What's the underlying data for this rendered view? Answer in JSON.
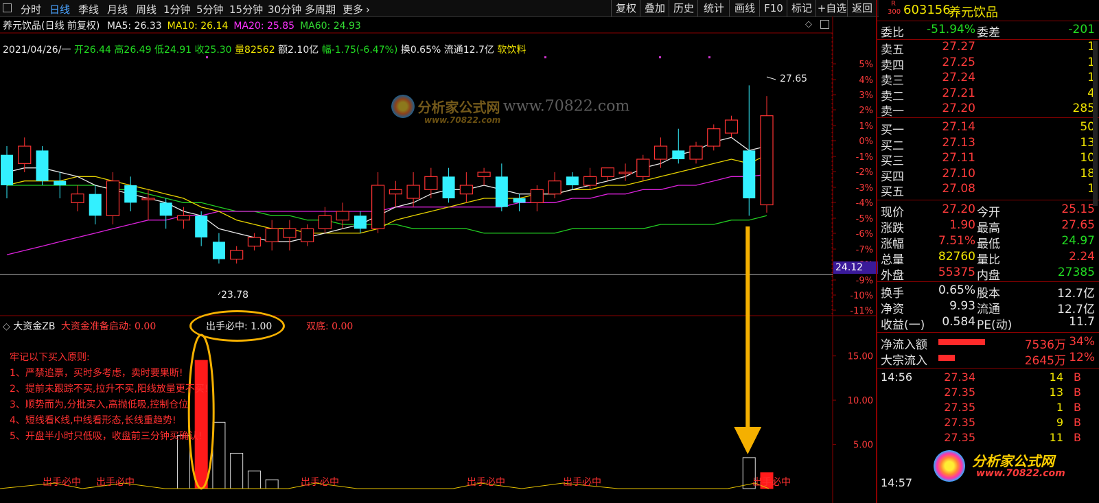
{
  "toolbar": {
    "tabs": [
      "分时",
      "日线",
      "季线",
      "月线",
      "周线",
      "1分钟",
      "5分钟",
      "15分钟",
      "30分钟",
      "多周期",
      "更多"
    ],
    "active_tab": "日线",
    "right_buttons": [
      "复权",
      "叠加",
      "历史",
      "统计",
      "画线",
      "F10",
      "标记",
      "+自选",
      "返回"
    ]
  },
  "title_bar": {
    "stock_title": "养元饮品(日线 前复权)",
    "ma": [
      {
        "label": "MA5: 26.33",
        "color": "#e8e8e8"
      },
      {
        "label": "MA10: 26.14",
        "color": "#f2e600"
      },
      {
        "label": "MA20: 25.85",
        "color": "#ff33ff"
      },
      {
        "label": "MA60: 24.93",
        "color": "#33dd33"
      }
    ]
  },
  "info_line": {
    "date": "2021/04/26/一",
    "open": "开26.44",
    "high": "高26.49",
    "low": "低24.91",
    "close": "收25.30",
    "vol": "量82562",
    "amount": "额2.10亿",
    "change": "幅-1.75(-6.47%)",
    "turnover": "换0.65%",
    "float": "流通12.7亿",
    "sector": "软饮料"
  },
  "price_axis": [
    "5%",
    "4%",
    "3%",
    "2%",
    "1%",
    "0%",
    "-1%",
    "-2%",
    "-3%",
    "-4%",
    "-5%",
    "-6%",
    "-7%",
    "-8%",
    "-9%",
    "-10%",
    "-11%"
  ],
  "price_marker": "24.12",
  "chart_annotations": {
    "high_label": "27.65",
    "low_label": "23.78"
  },
  "watermark": {
    "logo_text": "分析家公式网",
    "url": "www.70822.com",
    "sub": "www.70822.com"
  },
  "indicator": {
    "name": "大资金ZB",
    "signal1": "大资金准备启动: 0.00",
    "signal2": "出手必中: 1.00",
    "signal3": "双底: 0.00",
    "axis": [
      "15.00",
      "10.00",
      "5.00"
    ],
    "rules_title": "牢记以下买入原则:",
    "rules": [
      "1、严禁追票，买时多考虑，卖时要果断!",
      "2、提前未跟踪不买,拉升不买,阳线放量更不买!",
      "3、顺势而为,分批买入,高抛低吸,控制仓位",
      "4、短线看K线,中线看形态,长线重趋势!",
      "5、开盘半小时只低吸，收盘前三分钟买确认!"
    ],
    "bottom_label": "出手必中"
  },
  "right_panel": {
    "badge_top": "R",
    "badge_bottom": "300",
    "code": "603156",
    "name": "养元饮品",
    "weibi": {
      "label": "委比",
      "value": "-51.94%",
      "label2": "委差",
      "value2": "-201"
    },
    "sells": [
      {
        "label": "卖五",
        "price": "27.27",
        "vol": "1"
      },
      {
        "label": "卖四",
        "price": "27.25",
        "vol": "1"
      },
      {
        "label": "卖三",
        "price": "27.24",
        "vol": "1"
      },
      {
        "label": "卖二",
        "price": "27.21",
        "vol": "4"
      },
      {
        "label": "卖一",
        "price": "27.20",
        "vol": "285"
      }
    ],
    "buys": [
      {
        "label": "买一",
        "price": "27.14",
        "vol": "50"
      },
      {
        "label": "买二",
        "price": "27.13",
        "vol": "13"
      },
      {
        "label": "买三",
        "price": "27.11",
        "vol": "10"
      },
      {
        "label": "买四",
        "price": "27.10",
        "vol": "18"
      },
      {
        "label": "买五",
        "price": "27.08",
        "vol": "1"
      }
    ],
    "quotes": [
      {
        "l1": "现价",
        "v1": "27.20",
        "c1": "red",
        "l2": "今开",
        "v2": "25.15",
        "c2": "red"
      },
      {
        "l1": "涨跌",
        "v1": "1.90",
        "c1": "red",
        "l2": "最高",
        "v2": "27.65",
        "c2": "red"
      },
      {
        "l1": "涨幅",
        "v1": "7.51%",
        "c1": "red",
        "l2": "最低",
        "v2": "24.97",
        "c2": "green"
      },
      {
        "l1": "总量",
        "v1": "82760",
        "c1": "yellow",
        "l2": "量比",
        "v2": "2.24",
        "c2": "red"
      },
      {
        "l1": "外盘",
        "v1": "55375",
        "c1": "red",
        "l2": "内盘",
        "v2": "27385",
        "c2": "green"
      }
    ],
    "fundamentals": [
      {
        "l1": "换手",
        "v1": "0.65%",
        "l2": "股本",
        "v2": "12.7亿"
      },
      {
        "l1": "净资",
        "v1": "9.93",
        "l2": "流通",
        "v2": "12.7亿"
      },
      {
        "l1": "收益(一)",
        "v1": "0.584",
        "l2": "PE(动)",
        "v2": "11.7"
      }
    ],
    "flows": [
      {
        "label": "净流入额",
        "bar": 0.34,
        "amount": "7536万",
        "pct": "34%"
      },
      {
        "label": "大宗流入",
        "bar": 0.12,
        "amount": "2645万",
        "pct": "12%"
      }
    ],
    "ticks": [
      {
        "time": "14:56",
        "price": "27.34",
        "vol": "14",
        "side": "B"
      },
      {
        "time": "",
        "price": "27.35",
        "vol": "13",
        "side": "B"
      },
      {
        "time": "",
        "price": "27.35",
        "vol": "1",
        "side": "B"
      },
      {
        "time": "",
        "price": "27.35",
        "vol": "9",
        "side": "B"
      },
      {
        "time": "",
        "price": "27.35",
        "vol": "11",
        "side": "B"
      }
    ],
    "last_time": "14:57",
    "brand_text": "分析家公式网",
    "brand_url": "www.70822.com"
  },
  "chart_data": {
    "type": "candlestick",
    "price_range": [
      22.6,
      28.6
    ],
    "candles": [
      {
        "o": 26.3,
        "c": 25.6,
        "h": 26.5,
        "l": 25.3
      },
      {
        "o": 26.1,
        "c": 26.5,
        "h": 26.7,
        "l": 25.9
      },
      {
        "o": 26.4,
        "c": 25.7,
        "h": 26.5,
        "l": 25.6
      },
      {
        "o": 25.7,
        "c": 25.6,
        "h": 25.9,
        "l": 25.3
      },
      {
        "o": 25.2,
        "c": 25.4,
        "h": 25.6,
        "l": 25.0
      },
      {
        "o": 25.4,
        "c": 24.9,
        "h": 25.6,
        "l": 24.7
      },
      {
        "o": 24.9,
        "c": 25.7,
        "h": 25.9,
        "l": 24.7
      },
      {
        "o": 25.6,
        "c": 25.2,
        "h": 25.8,
        "l": 25.0
      },
      {
        "o": 25.3,
        "c": 25.3,
        "h": 25.5,
        "l": 24.8
      },
      {
        "o": 25.2,
        "c": 24.9,
        "h": 25.3,
        "l": 24.6
      },
      {
        "o": 24.8,
        "c": 24.9,
        "h": 25.1,
        "l": 24.6
      },
      {
        "o": 24.9,
        "c": 24.4,
        "h": 25.0,
        "l": 24.2
      },
      {
        "o": 24.3,
        "c": 23.9,
        "h": 24.5,
        "l": 23.8
      },
      {
        "o": 23.9,
        "c": 24.1,
        "h": 24.2,
        "l": 23.8
      },
      {
        "o": 24.2,
        "c": 24.4,
        "h": 24.5,
        "l": 24.1
      },
      {
        "o": 24.3,
        "c": 24.6,
        "h": 24.8,
        "l": 24.1
      },
      {
        "o": 24.4,
        "c": 24.6,
        "h": 24.8,
        "l": 24.1
      },
      {
        "o": 24.3,
        "c": 24.6,
        "h": 24.7,
        "l": 24.2
      },
      {
        "o": 24.6,
        "c": 24.9,
        "h": 25.1,
        "l": 24.5
      },
      {
        "o": 24.8,
        "c": 25.0,
        "h": 25.2,
        "l": 24.6
      },
      {
        "o": 24.9,
        "c": 24.6,
        "h": 25.0,
        "l": 24.5
      },
      {
        "o": 24.6,
        "c": 25.6,
        "h": 25.9,
        "l": 24.5
      },
      {
        "o": 25.4,
        "c": 25.5,
        "h": 25.7,
        "l": 25.1
      },
      {
        "o": 25.3,
        "c": 25.6,
        "h": 25.9,
        "l": 25.1
      },
      {
        "o": 25.5,
        "c": 25.8,
        "h": 26.0,
        "l": 25.3
      },
      {
        "o": 25.8,
        "c": 25.3,
        "h": 26.0,
        "l": 25.2
      },
      {
        "o": 25.4,
        "c": 25.6,
        "h": 25.9,
        "l": 25.2
      },
      {
        "o": 25.8,
        "c": 25.9,
        "h": 26.0,
        "l": 25.6
      },
      {
        "o": 25.8,
        "c": 25.1,
        "h": 26.1,
        "l": 25.0
      },
      {
        "o": 25.3,
        "c": 25.2,
        "h": 25.4,
        "l": 25.0
      },
      {
        "o": 25.2,
        "c": 25.5,
        "h": 25.6,
        "l": 25.0
      },
      {
        "o": 25.4,
        "c": 25.7,
        "h": 25.9,
        "l": 25.3
      },
      {
        "o": 25.8,
        "c": 25.6,
        "h": 25.9,
        "l": 25.5
      },
      {
        "o": 25.6,
        "c": 25.8,
        "h": 26.0,
        "l": 25.5
      },
      {
        "o": 25.8,
        "c": 26.0,
        "h": 26.0,
        "l": 25.7
      },
      {
        "o": 25.9,
        "c": 25.9,
        "h": 26.1,
        "l": 25.7
      },
      {
        "o": 25.8,
        "c": 26.2,
        "h": 26.3,
        "l": 25.7
      },
      {
        "o": 26.2,
        "c": 26.5,
        "h": 26.7,
        "l": 26.0
      },
      {
        "o": 26.4,
        "c": 26.2,
        "h": 26.9,
        "l": 26.1
      },
      {
        "o": 26.2,
        "c": 26.5,
        "h": 26.6,
        "l": 26.1
      },
      {
        "o": 26.5,
        "c": 26.9,
        "h": 27.0,
        "l": 26.4
      },
      {
        "o": 26.8,
        "c": 27.1,
        "h": 27.2,
        "l": 26.7
      },
      {
        "o": 26.4,
        "c": 25.3,
        "h": 27.9,
        "l": 24.9
      },
      {
        "o": 25.15,
        "c": 27.2,
        "h": 27.65,
        "l": 24.97
      }
    ],
    "ma5": [
      25.9,
      26.0,
      26.0,
      25.9,
      25.8,
      25.6,
      25.5,
      25.4,
      25.3,
      25.2,
      25.0,
      24.9,
      24.6,
      24.5,
      24.4,
      24.3,
      24.3,
      24.4,
      24.5,
      24.6,
      24.7,
      24.9,
      25.1,
      25.2,
      25.4,
      25.5,
      25.5,
      25.6,
      25.5,
      25.4,
      25.4,
      25.4,
      25.5,
      25.6,
      25.7,
      25.8,
      26.0,
      26.1,
      26.3,
      26.4,
      26.6,
      26.7,
      26.4,
      26.5
    ],
    "ma10": [
      25.6,
      25.7,
      25.7,
      25.7,
      25.8,
      25.8,
      25.7,
      25.6,
      25.5,
      25.4,
      25.3,
      25.1,
      25.0,
      24.8,
      24.7,
      24.6,
      24.6,
      24.5,
      24.5,
      24.5,
      24.5,
      24.6,
      24.8,
      24.9,
      25.0,
      25.1,
      25.2,
      25.3,
      25.3,
      25.3,
      25.4,
      25.4,
      25.5,
      25.5,
      25.6,
      25.6,
      25.7,
      25.8,
      25.9,
      26.0,
      26.1,
      26.2,
      26.1,
      26.3
    ],
    "ma20": [
      24.0,
      24.1,
      24.2,
      24.3,
      24.4,
      24.5,
      24.6,
      24.7,
      24.8,
      24.8,
      24.9,
      24.9,
      25.0,
      25.0,
      25.0,
      25.0,
      25.0,
      25.0,
      25.0,
      25.0,
      25.0,
      25.0,
      25.1,
      25.1,
      25.1,
      25.1,
      25.1,
      25.1,
      25.1,
      25.2,
      25.2,
      25.2,
      25.3,
      25.3,
      25.4,
      25.4,
      25.5,
      25.5,
      25.6,
      25.6,
      25.7,
      25.8,
      25.8,
      25.85
    ],
    "ma60": [
      25.6,
      25.6,
      25.6,
      25.6,
      25.6,
      25.6,
      25.5,
      25.5,
      25.4,
      25.3,
      25.2,
      25.2,
      25.1,
      25.0,
      25.0,
      24.9,
      24.9,
      24.8,
      24.8,
      24.7,
      24.7,
      24.7,
      24.7,
      24.6,
      24.6,
      24.6,
      24.6,
      24.5,
      24.5,
      24.5,
      24.5,
      24.5,
      24.6,
      24.6,
      24.6,
      24.6,
      24.6,
      24.7,
      24.7,
      24.7,
      24.7,
      24.8,
      24.8,
      24.9
    ],
    "indicator_range": [
      0,
      18
    ],
    "indicator_bars": [
      0,
      0,
      0,
      0,
      0,
      0,
      0,
      0,
      0,
      0,
      6,
      14.5,
      7.5,
      4,
      2,
      1,
      0,
      0,
      0,
      0,
      0,
      0,
      0,
      0,
      0,
      0,
      0,
      0,
      0,
      0,
      0,
      0,
      0,
      0,
      0,
      0,
      0,
      0,
      0,
      0,
      0,
      0,
      3.5,
      1.8
    ],
    "indicator_red": [
      11,
      43
    ]
  }
}
